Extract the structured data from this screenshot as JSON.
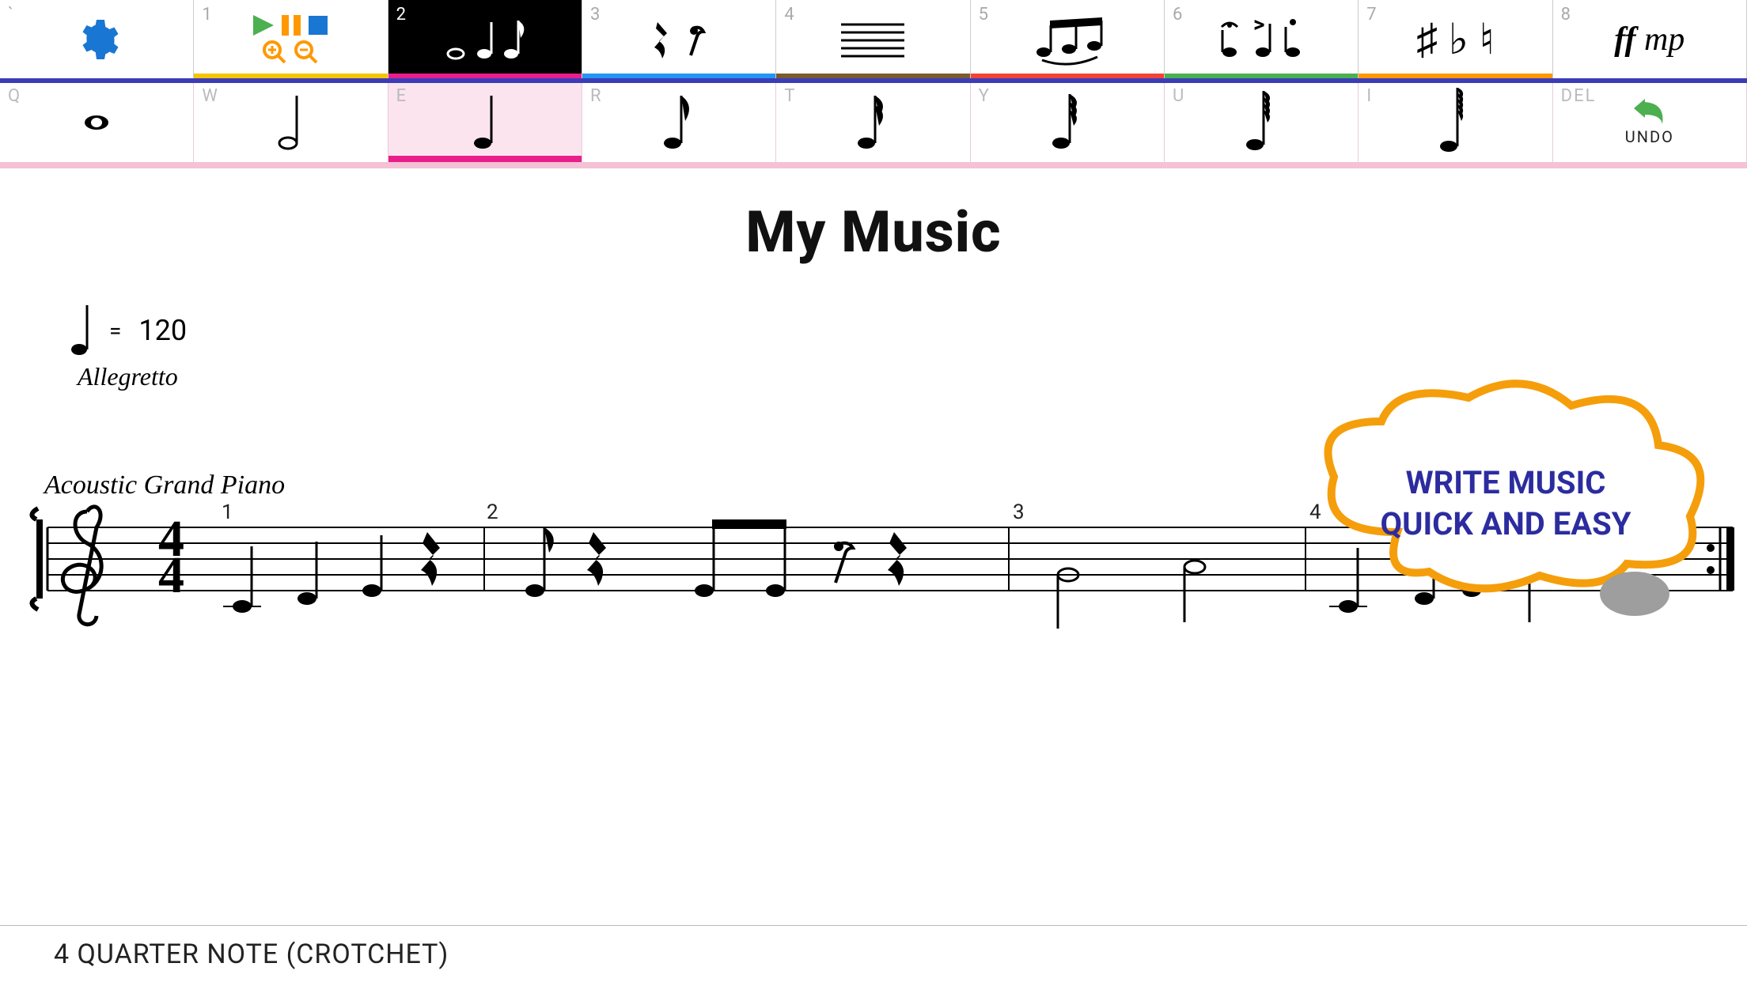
{
  "toolbar1": {
    "cells": [
      {
        "key": "`",
        "name": "settings"
      },
      {
        "key": "1",
        "name": "playback-view"
      },
      {
        "key": "2",
        "name": "note-value-palette"
      },
      {
        "key": "3",
        "name": "rests-palette"
      },
      {
        "key": "4",
        "name": "staff-lines"
      },
      {
        "key": "5",
        "name": "beams-ties"
      },
      {
        "key": "6",
        "name": "articulations"
      },
      {
        "key": "7",
        "name": "accidentals"
      },
      {
        "key": "8",
        "name": "dynamics",
        "dyn1": "ff",
        "dyn2": "mp"
      }
    ],
    "active": 2
  },
  "toolbar2": {
    "cells": [
      {
        "key": "Q",
        "name": "whole-note"
      },
      {
        "key": "W",
        "name": "half-note"
      },
      {
        "key": "E",
        "name": "quarter-note"
      },
      {
        "key": "R",
        "name": "eighth-note"
      },
      {
        "key": "T",
        "name": "sixteenth-note"
      },
      {
        "key": "Y",
        "name": "thirtysecond-note"
      },
      {
        "key": "U",
        "name": "sixtyfourth-note"
      },
      {
        "key": "I",
        "name": "hundredtwentyeighth-note"
      },
      {
        "key": "DEL",
        "name": "undo",
        "label": "UNDO"
      }
    ],
    "active": 2
  },
  "score": {
    "title": "My Music",
    "tempo_eq": "=",
    "tempo_value": "120",
    "tempo_term": "Allegretto",
    "instrument": "Acoustic Grand Piano",
    "measures": [
      "1",
      "2",
      "3",
      "4"
    ]
  },
  "callout": {
    "line1": "WRITE MUSIC",
    "line2": "QUICK AND EASY"
  },
  "status": {
    "text": "4 QUARTER NOTE (CROTCHET)"
  }
}
